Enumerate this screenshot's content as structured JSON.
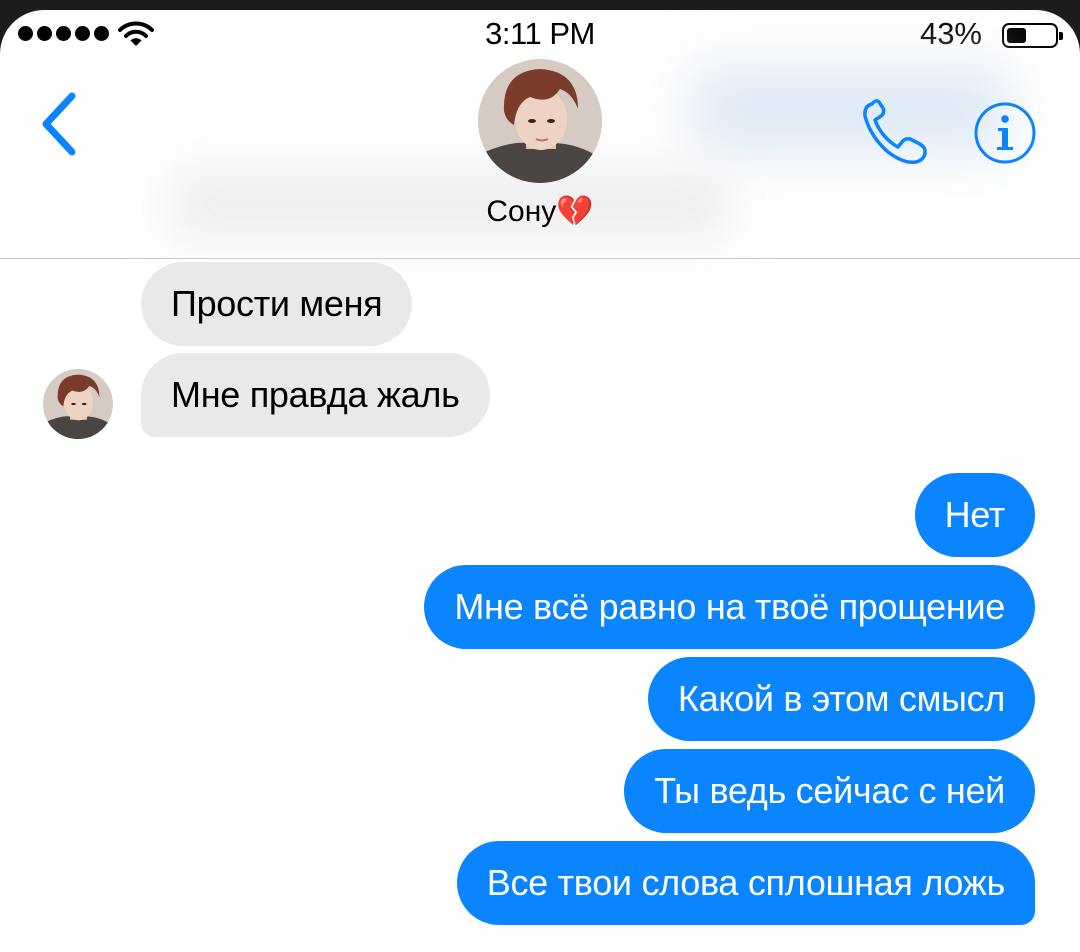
{
  "status_bar": {
    "time": "3:11 PM",
    "battery_percent": "43%",
    "battery_level": 0.43,
    "signal_bars": 5
  },
  "header": {
    "contact_name": "Сону💔",
    "back_icon": "chevron-left-icon",
    "call_icon": "phone-icon",
    "info_icon": "info-icon",
    "accent_color": "#0b84ff"
  },
  "messages": [
    {
      "direction": "incoming",
      "text": "Прости меня"
    },
    {
      "direction": "incoming",
      "text": "Мне правда жаль"
    },
    {
      "direction": "outgoing",
      "text": "Нет"
    },
    {
      "direction": "outgoing",
      "text": "Мне всё равно на твоё прощение"
    },
    {
      "direction": "outgoing",
      "text": "Какой в этом смысл"
    },
    {
      "direction": "outgoing",
      "text": "Ты ведь сейчас с ней"
    },
    {
      "direction": "outgoing",
      "text": "Все твои слова сплошная ложь"
    }
  ],
  "colors": {
    "incoming_bubble": "#e9e9eb",
    "outgoing_bubble": "#0b84ff"
  }
}
